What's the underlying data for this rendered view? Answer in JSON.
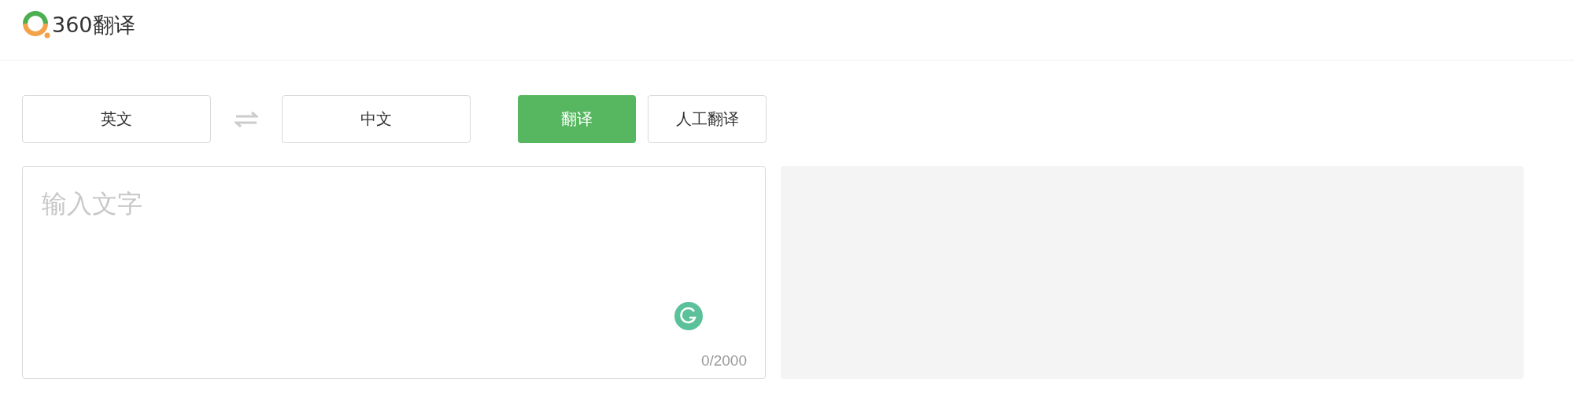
{
  "header": {
    "logo_text": "360翻译"
  },
  "toolbar": {
    "source_language": "英文",
    "target_language": "中文",
    "translate_button": "翻译",
    "human_translation_button": "人工翻译"
  },
  "input": {
    "placeholder": "输入文字",
    "counter": "0/2000"
  }
}
